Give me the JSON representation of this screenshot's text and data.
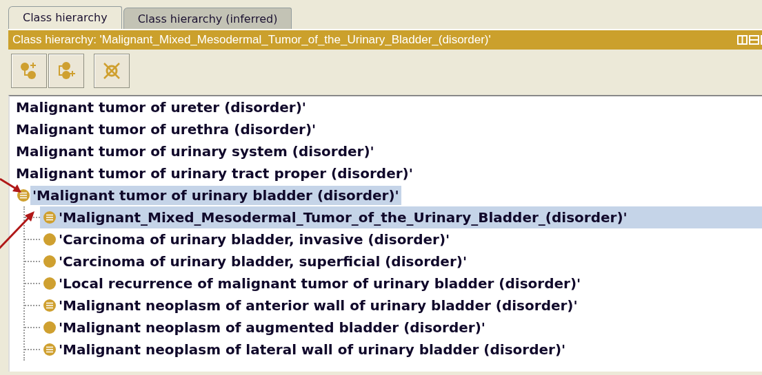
{
  "tabs": [
    {
      "label": "Class hierarchy",
      "selected": true
    },
    {
      "label": "Class hierarchy (inferred)",
      "selected": false
    }
  ],
  "title_bar": {
    "text": "Class hierarchy: 'Malignant_Mixed_Mesodermal_Tumor_of_the_Urinary_Bladder_(disorder)'"
  },
  "tree": {
    "items": [
      {
        "label": "Malignant tumor of ureter (disorder)'",
        "kind": "none",
        "selected": false,
        "arrow": false
      },
      {
        "label": "Malignant tumor of urethra (disorder)'",
        "kind": "none",
        "selected": false,
        "arrow": false
      },
      {
        "label": "Malignant tumor of urinary system (disorder)'",
        "kind": "none",
        "selected": false,
        "arrow": false
      },
      {
        "label": "Malignant tumor of urinary tract proper (disorder)'",
        "kind": "none",
        "selected": false,
        "arrow": false
      },
      {
        "label": "'Malignant tumor of urinary bladder (disorder)'",
        "kind": "defined",
        "selected": true,
        "arrow": true,
        "children": [
          {
            "label": "'Malignant_Mixed_Mesodermal_Tumor_of_the_Urinary_Bladder_(disorder)'",
            "kind": "defined",
            "selected": true,
            "arrow": true
          },
          {
            "label": "'Carcinoma of urinary bladder, invasive (disorder)'",
            "kind": "primitive",
            "selected": false,
            "arrow": false
          },
          {
            "label": "'Carcinoma of urinary bladder, superficial (disorder)'",
            "kind": "primitive",
            "selected": false,
            "arrow": false
          },
          {
            "label": "'Local recurrence of malignant tumor of urinary bladder (disorder)'",
            "kind": "primitive",
            "selected": false,
            "arrow": false
          },
          {
            "label": "'Malignant neoplasm of anterior wall of urinary bladder (disorder)'",
            "kind": "defined",
            "selected": false,
            "arrow": false
          },
          {
            "label": "'Malignant neoplasm of augmented bladder (disorder)'",
            "kind": "primitive",
            "selected": false,
            "arrow": false
          },
          {
            "label": "'Malignant neoplasm of lateral wall of urinary bladder (disorder)'",
            "kind": "defined",
            "selected": false,
            "arrow": false
          }
        ]
      }
    ]
  }
}
